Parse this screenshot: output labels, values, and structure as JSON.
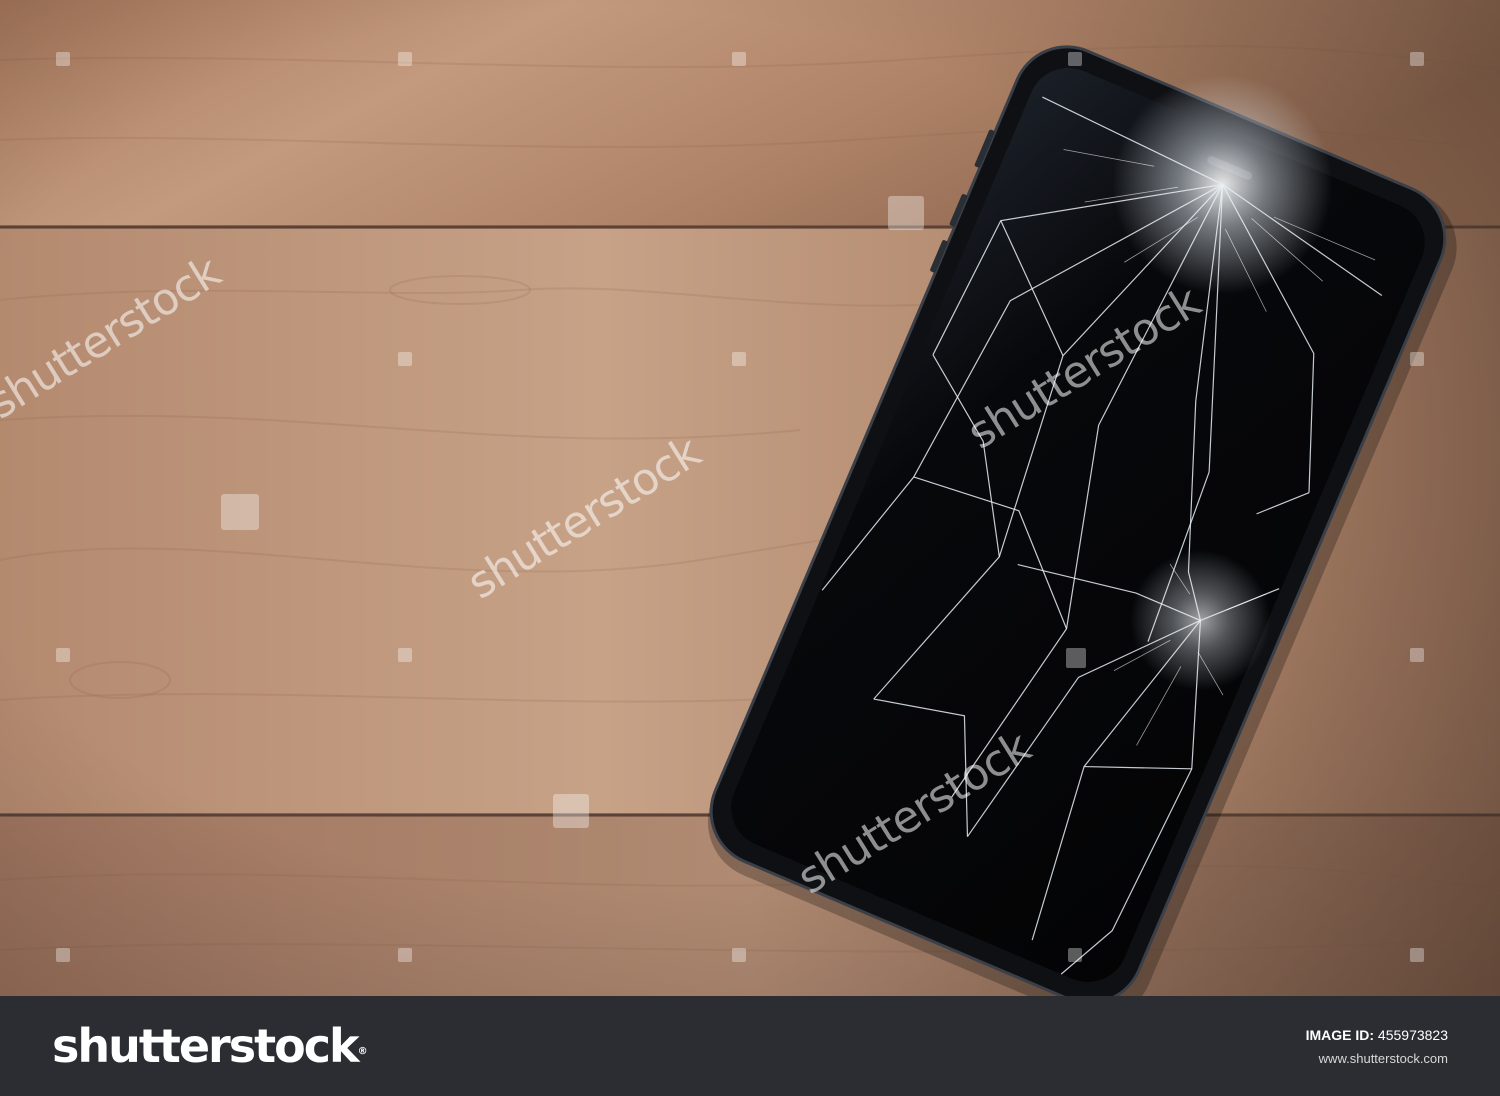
{
  "photo": {
    "subject": "broken-smartphone-on-wood-table",
    "watermark_text": "shutterstock",
    "colors": {
      "wood_light": "#b88c6e",
      "wood_mid": "#a57a5d",
      "wood_dark": "#7c5a45",
      "phone_body": "#0e1014",
      "screen": "#06070a",
      "cracks": "#e8eef4"
    }
  },
  "footer": {
    "logo_text": "shutterstock",
    "logo_reg": "®",
    "image_id_label": "IMAGE ID:",
    "image_id_value": "455973823",
    "site_url": "www.shutterstock.com",
    "background": "#2b2d33"
  }
}
